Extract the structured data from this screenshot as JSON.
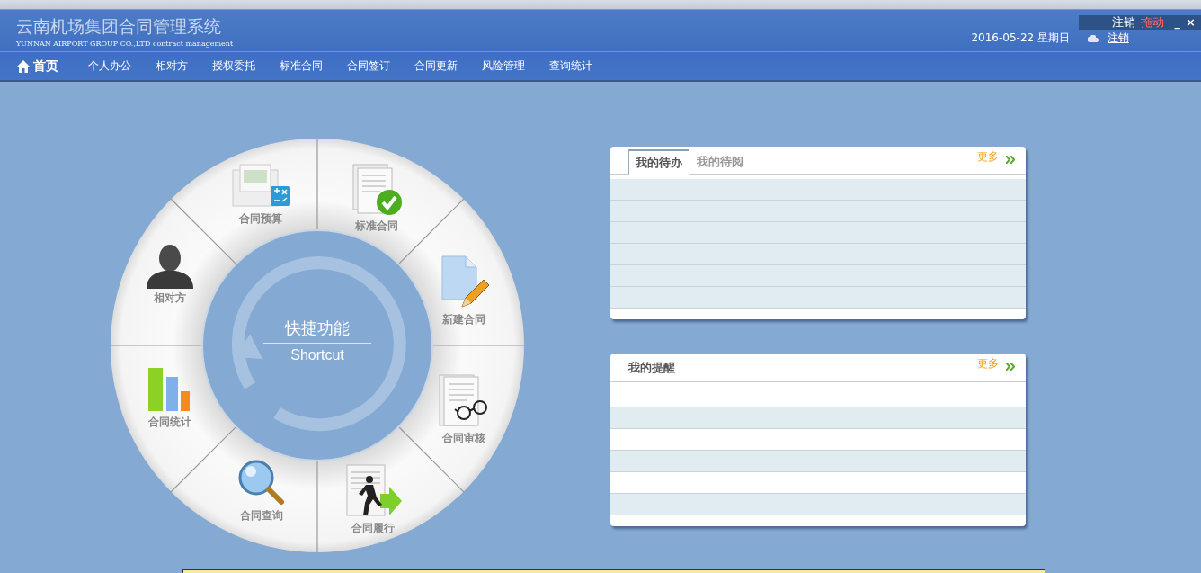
{
  "header": {
    "title": "云南机场集团合同管理系统",
    "subtitle": "YUNNAN AIRPORT GROUP CO.,LTD contract management",
    "date": "2016-05-22 星期日",
    "logout_link": "注销"
  },
  "float_bar": {
    "logout": "注销",
    "drag": "拖动",
    "minimize": "_",
    "close": "×"
  },
  "nav": [
    {
      "label": "首页",
      "selected": true
    },
    {
      "label": "个人办公",
      "selected": false
    },
    {
      "label": "相对方",
      "selected": false
    },
    {
      "label": "授权委托",
      "selected": false
    },
    {
      "label": "标准合同",
      "selected": false
    },
    {
      "label": "合同签订",
      "selected": false
    },
    {
      "label": "合同更新",
      "selected": false
    },
    {
      "label": "风险管理",
      "selected": false
    },
    {
      "label": "查询统计",
      "selected": false
    }
  ],
  "shortcut": {
    "title": "快捷功能",
    "subtitle": "Shortcut",
    "items": [
      {
        "label": "合同预算",
        "kind": "budget"
      },
      {
        "label": "标准合同",
        "kind": "standard"
      },
      {
        "label": "新建合同",
        "kind": "new"
      },
      {
        "label": "合同审核",
        "kind": "review"
      },
      {
        "label": "合同履行",
        "kind": "perform"
      },
      {
        "label": "合同查询",
        "kind": "search"
      },
      {
        "label": "合同统计",
        "kind": "stats"
      },
      {
        "label": "相对方",
        "kind": "person"
      }
    ]
  },
  "todo_panel": {
    "tabs": [
      {
        "label": "我的待办",
        "selected": true
      },
      {
        "label": "我的待阅",
        "selected": false
      }
    ],
    "more": "更多",
    "rows": [
      {
        "shaded": true
      },
      {
        "shaded": true
      },
      {
        "shaded": true
      },
      {
        "shaded": true
      },
      {
        "shaded": true
      },
      {
        "shaded": true
      }
    ]
  },
  "reminder_panel": {
    "title": "我的提醒",
    "more": "更多",
    "rows": [
      {
        "shaded": false
      },
      {
        "shaded": true
      },
      {
        "shaded": false
      },
      {
        "shaded": true
      },
      {
        "shaded": false
      },
      {
        "shaded": true
      }
    ]
  }
}
